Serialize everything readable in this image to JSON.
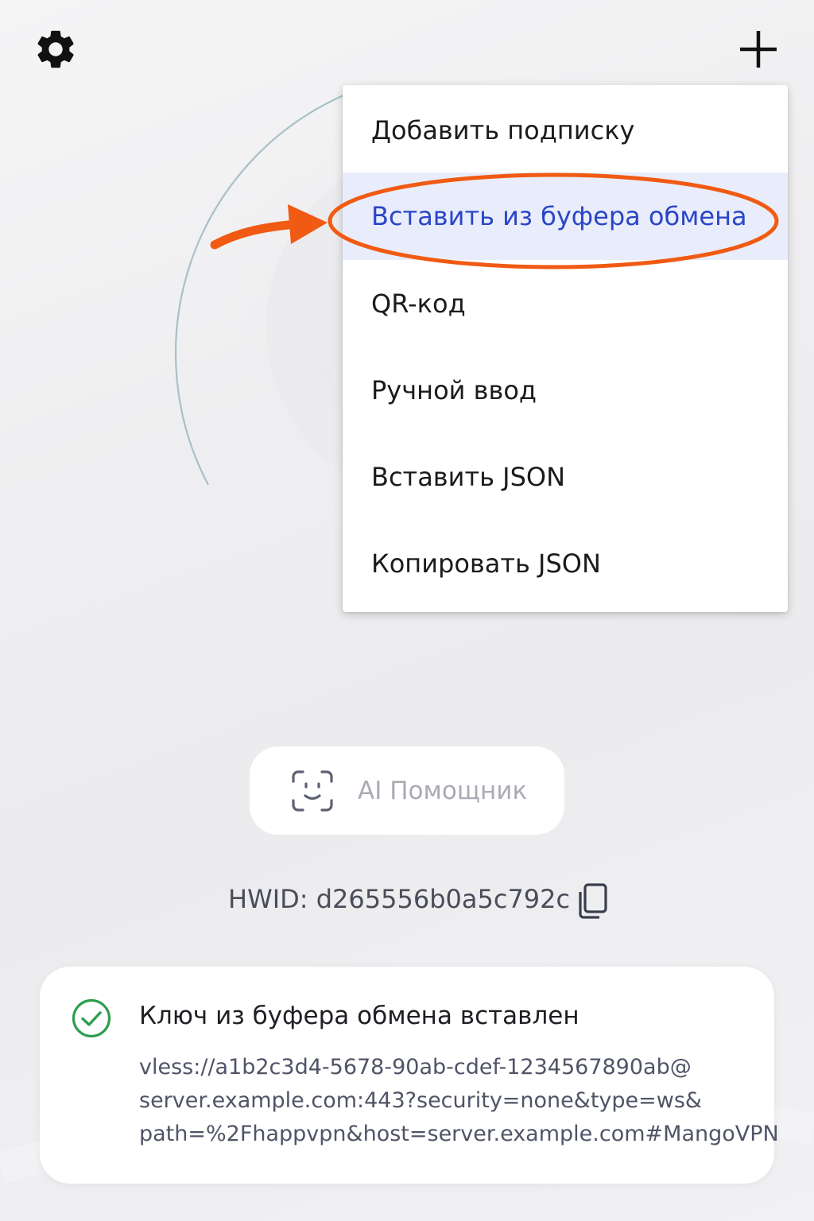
{
  "header": {
    "settings_icon": "gear-icon",
    "add_icon": "plus-icon"
  },
  "menu": {
    "items": [
      {
        "label": "Добавить подписку"
      },
      {
        "label": "Вставить из буфера обмена",
        "highlighted": true
      },
      {
        "label": "QR-код"
      },
      {
        "label": "Ручной ввод"
      },
      {
        "label": "Вставить JSON"
      },
      {
        "label": "Копировать JSON"
      }
    ]
  },
  "annotation": {
    "color": "#f15a12",
    "target": "Вставить из буфера обмена"
  },
  "ai_assistant": {
    "label": "AI Помощник",
    "icon": "face-scan-icon"
  },
  "hwid": {
    "text": "HWID: d265556b0a5c792c",
    "copy_icon": "copy-icon"
  },
  "toast": {
    "title": "Ключ из буфера обмена вставлен",
    "lines": [
      "vless://a1b2c3d4-5678-90ab-cdef-1234567890ab@",
      "server.example.com:443?security=none&type=ws&",
      "path=%2Fhappvpn&host=server.example.com#MangoVPN"
    ],
    "icon": "check-circle-icon",
    "status_color": "#2e9e4f"
  },
  "colors": {
    "accent": "#2a45c7",
    "highlight_bg": "#e9edfb",
    "annotation": "#f15a12"
  }
}
